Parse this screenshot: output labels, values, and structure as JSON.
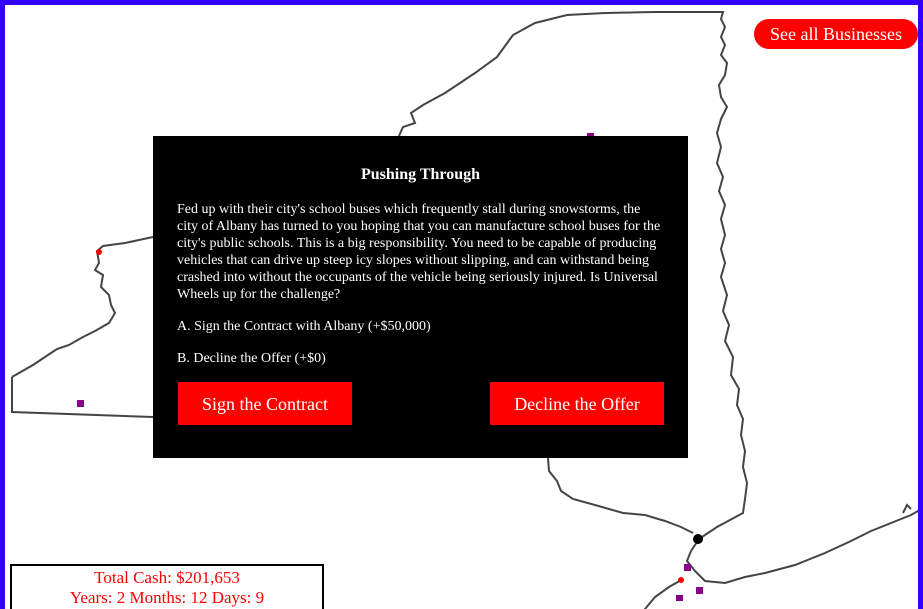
{
  "header": {
    "see_all_label": "See all Businesses"
  },
  "dialog": {
    "title": "Pushing Through",
    "body": "Fed up with their city's school buses which frequently stall during snowstorms, the city of Albany has turned to you hoping that you can manufacture school buses for the city's public schools. This is a big responsibility. You need to be capable of producing vehicles that can drive up steep icy slopes without slipping, and can withstand being crashed into without the occupants of the vehicle being seriously injured. Is Universal Wheels up for the challenge?",
    "option_a": "A. Sign the Contract with Albany (+$50,000)",
    "option_b": "B. Decline the Offer (+$0)",
    "accept_label": "Sign the Contract",
    "decline_label": "Decline the Offer"
  },
  "status": {
    "cash": "Total Cash: $201,653",
    "time": "Years: 2 Months: 12 Days: 9"
  },
  "colors": {
    "frame": "#3300ff",
    "accent": "#ff0000",
    "business_marker": "#8b008b",
    "player_marker": "#000000"
  }
}
